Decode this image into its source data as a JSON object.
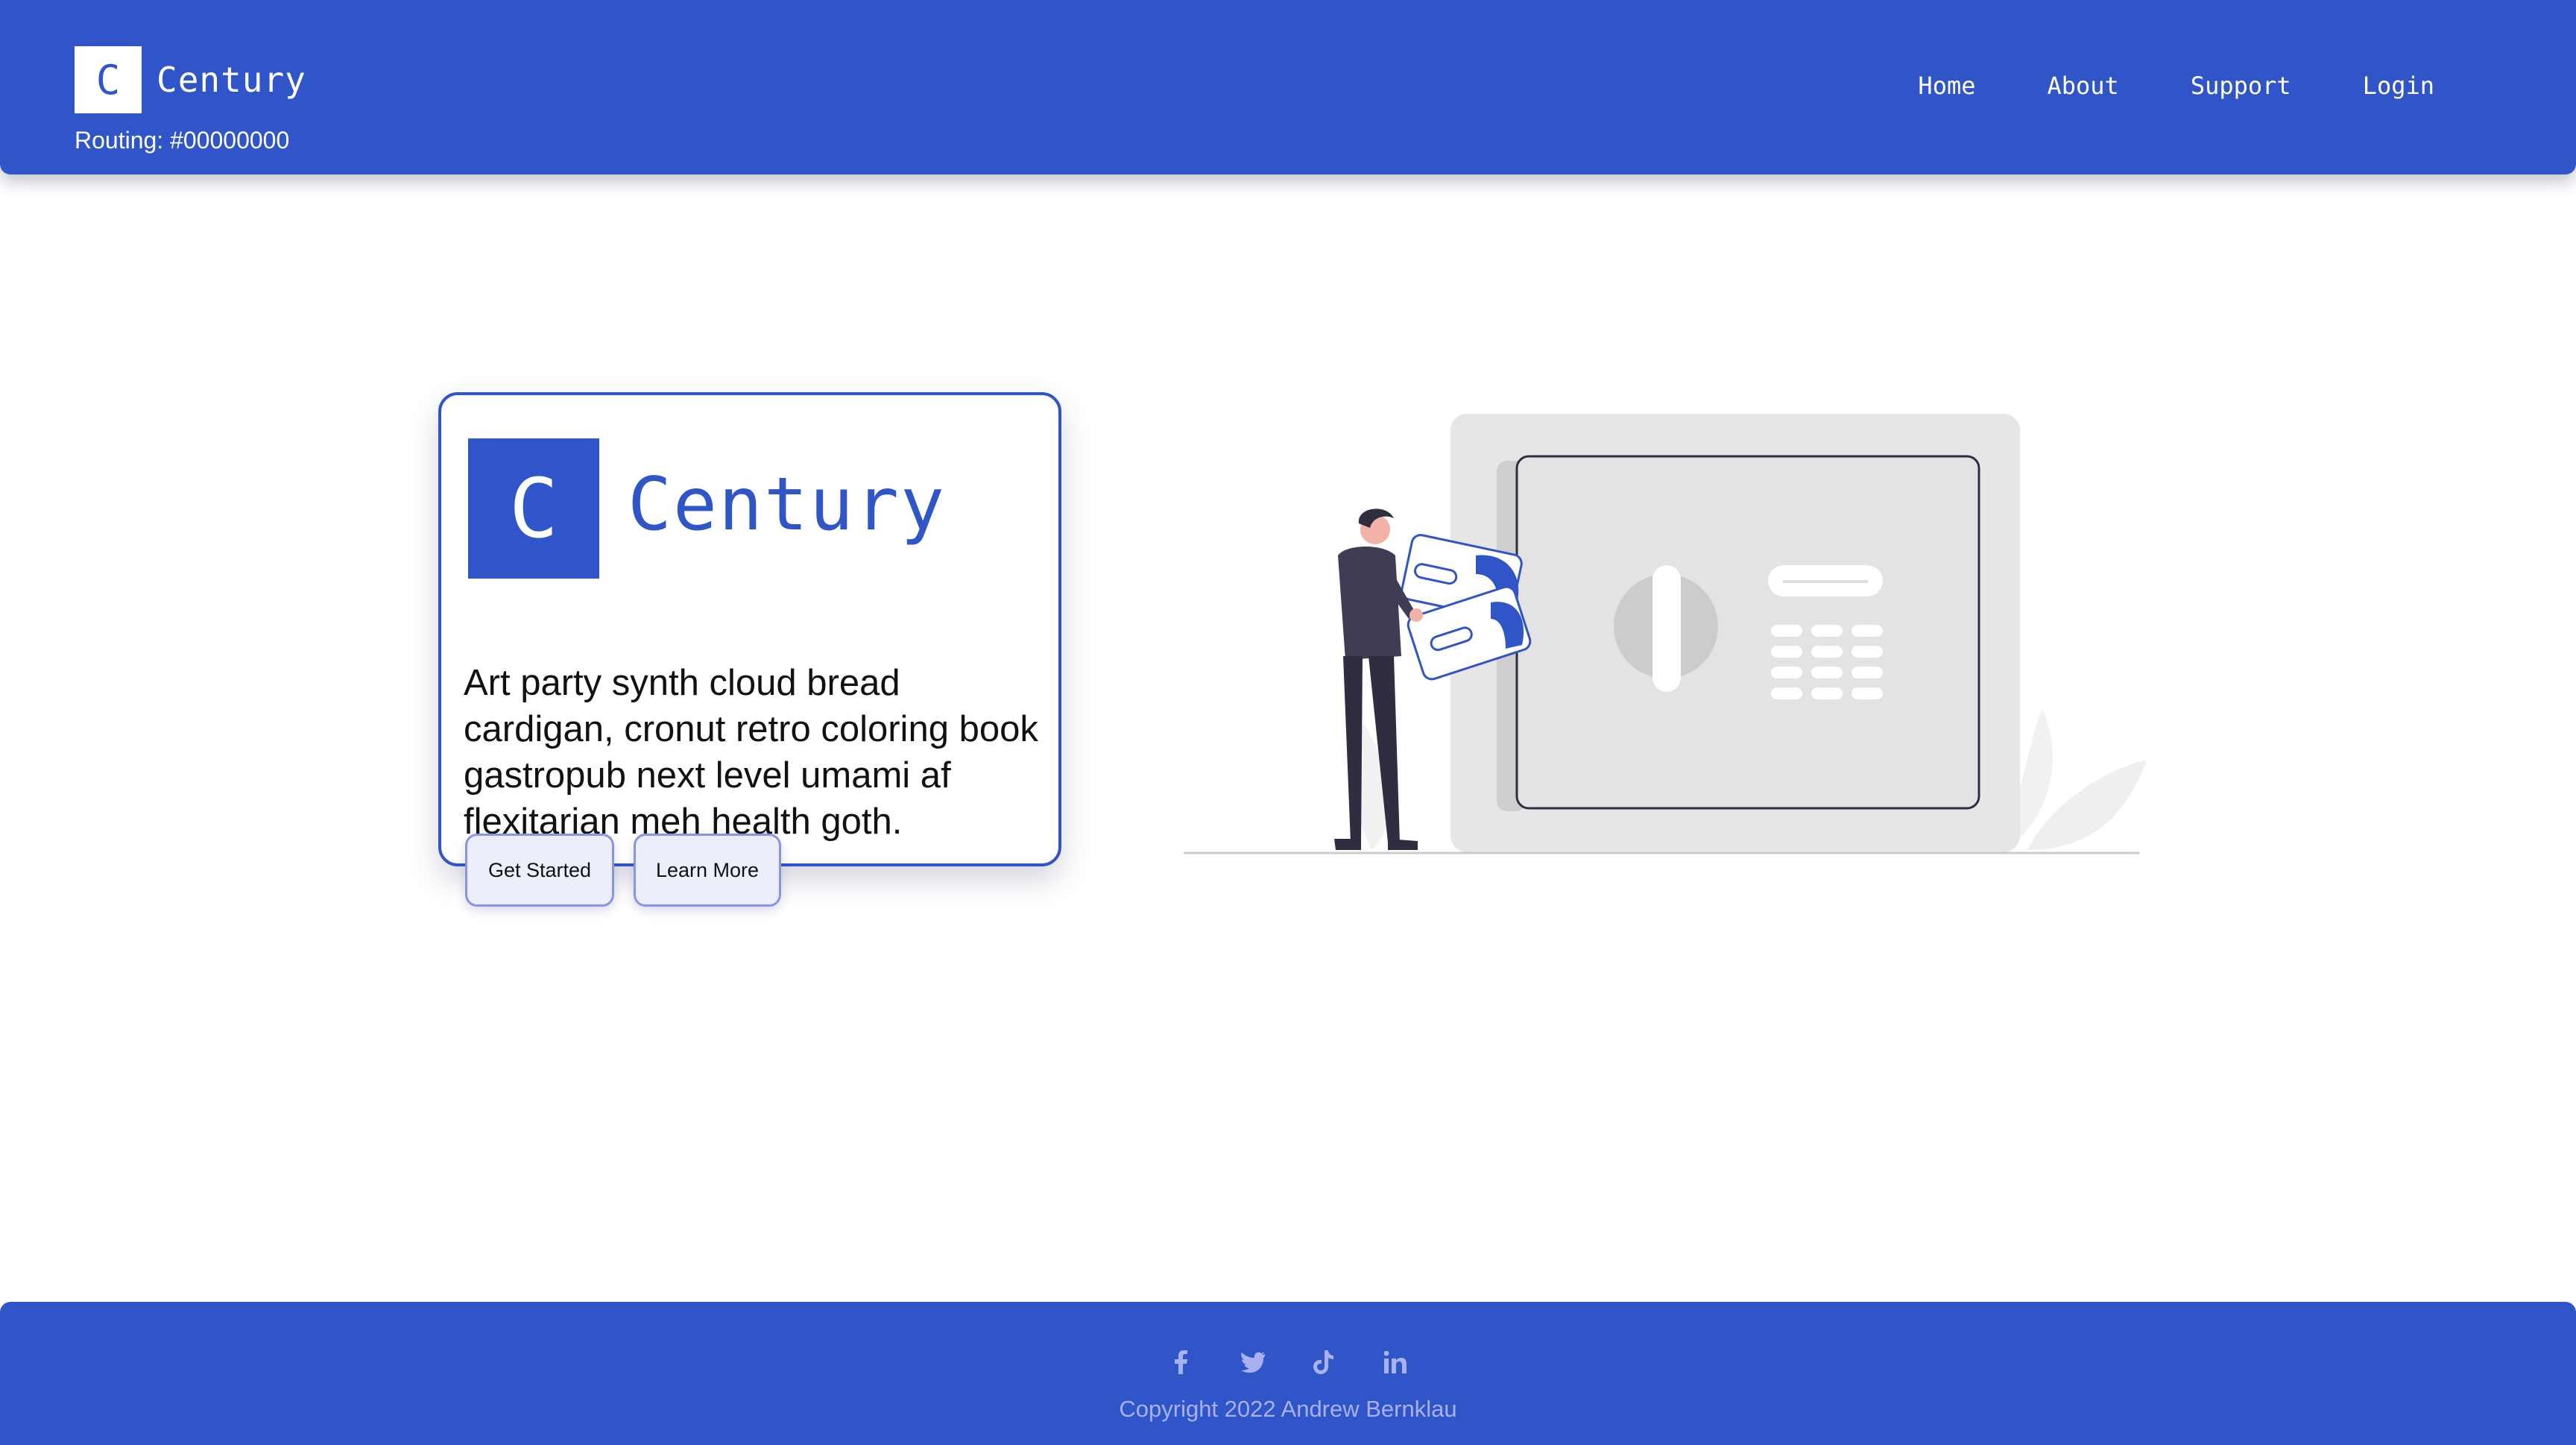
{
  "header": {
    "logo_letter": "C",
    "brand_name": "Century",
    "routing": "Routing: #00000000",
    "nav": [
      {
        "label": "Home"
      },
      {
        "label": "About"
      },
      {
        "label": "Support"
      },
      {
        "label": "Login"
      }
    ]
  },
  "hero": {
    "logo_letter": "C",
    "title": "Century",
    "text": "Art party synth cloud bread cardigan, cronut retro coloring book gastropub next level umami af flexitarian meh health goth.",
    "buttons": {
      "primary": "Get Started",
      "secondary": "Learn More"
    },
    "illustration": "person-depositing-money-into-safe"
  },
  "footer": {
    "social_icons": [
      "facebook-icon",
      "twitter-icon",
      "tiktok-icon",
      "linkedin-icon"
    ],
    "copyright": "Copyright 2022 Andrew Bernklau"
  },
  "colors": {
    "brand": "#3055c8",
    "button_bg": "#eceef9",
    "button_border": "#8a93e6",
    "footer_text": "#a9b1f0"
  }
}
